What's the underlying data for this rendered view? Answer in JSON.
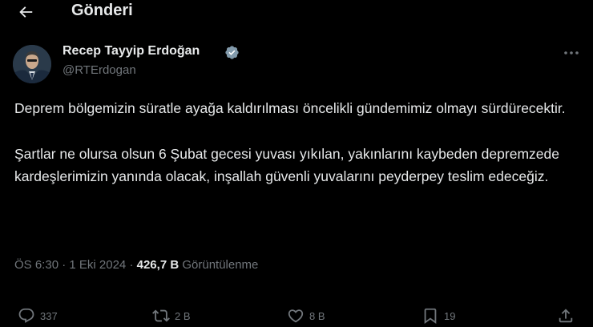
{
  "header": {
    "title": "Gönderi",
    "back_icon": "arrow-left-icon"
  },
  "author": {
    "name": "Recep Tayyip Erdoğan",
    "handle": "@RTErdogan",
    "verified_icon": "verified-badge-icon",
    "verified_color": "#1d9bf0"
  },
  "tweet": {
    "paragraph_1": "Deprem bölgemizin süratle ayağa kaldırılması öncelikli gündemimiz olmayı sürdürecektir.",
    "paragraph_2": "Şartlar ne olursa olsun 6 Şubat gecesi yuvası yıkılan, yakınlarını kaybeden depremzede kardeşlerimizin yanında olacak, inşallah güvenli yuvalarını peyderpey teslim edeceğiz."
  },
  "meta": {
    "time": "ÖS 6:30",
    "separator": " · ",
    "date": "1 Eki 2024",
    "views_count": "426,7 B",
    "views_label": "Görüntülenme"
  },
  "actions": {
    "replies": {
      "icon": "reply-icon",
      "count": "337"
    },
    "retweets": {
      "icon": "retweet-icon",
      "count": "2 B"
    },
    "likes": {
      "icon": "heart-icon",
      "count": "8 B"
    },
    "bookmarks": {
      "icon": "bookmark-icon",
      "count": "19"
    },
    "share": {
      "icon": "share-icon"
    }
  },
  "colors": {
    "background": "#000000",
    "text": "#e7e9ea",
    "secondary": "#71767b"
  }
}
